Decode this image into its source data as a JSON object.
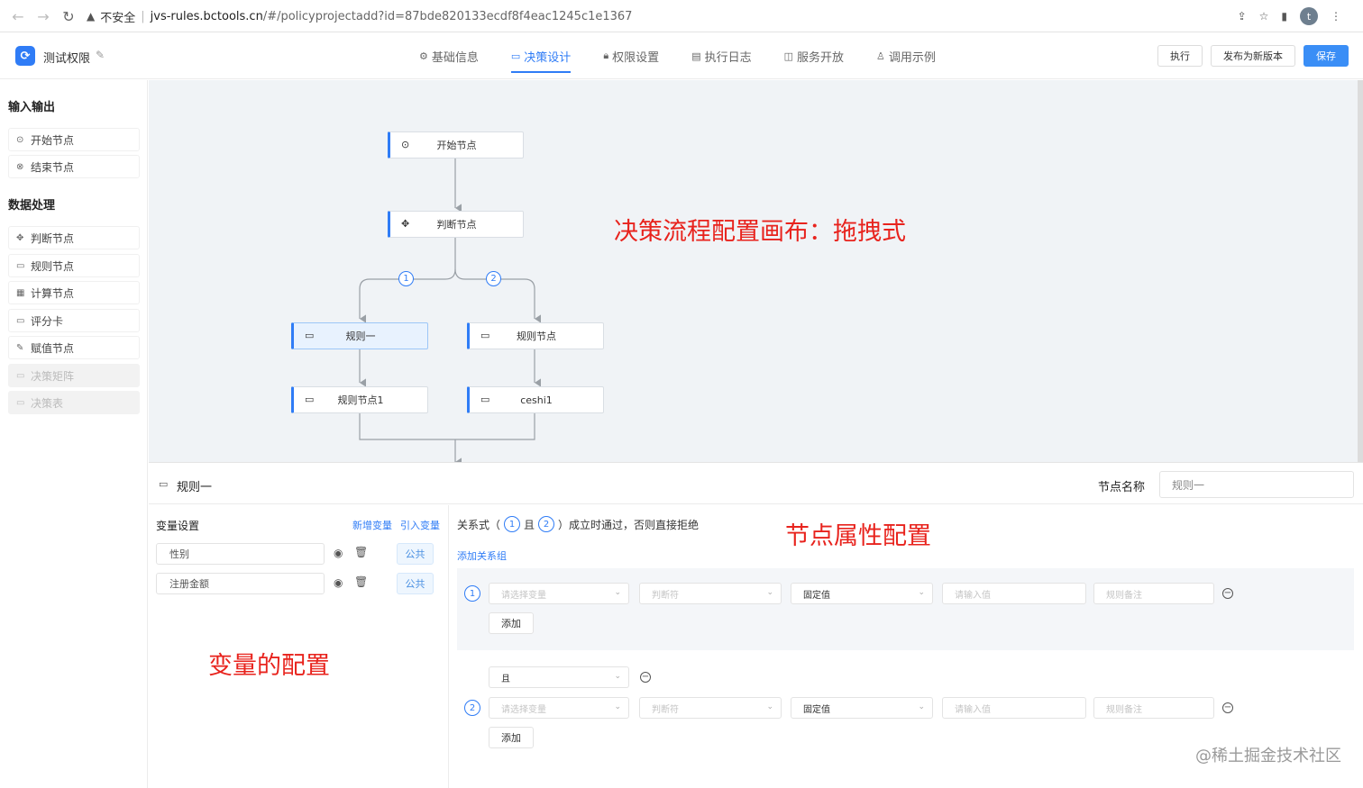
{
  "browser": {
    "security_label": "不安全",
    "url_host": "jvs-rules.bctools.cn",
    "url_path": "/#/policyprojectadd?id=87bde820133ecdf8f4eac1245c1e1367",
    "avatar_letter": "t"
  },
  "header": {
    "project_name": "测试权限",
    "tabs": [
      {
        "label": "基础信息",
        "icon": "gear-icon"
      },
      {
        "label": "决策设计",
        "icon": "monitor-icon",
        "active": true
      },
      {
        "label": "权限设置",
        "icon": "lock-icon"
      },
      {
        "label": "执行日志",
        "icon": "document-icon"
      },
      {
        "label": "服务开放",
        "icon": "book-icon"
      },
      {
        "label": "调用示例",
        "icon": "thumb-icon"
      }
    ],
    "buttons": {
      "run": "执行",
      "publish": "发布为新版本",
      "save": "保存"
    },
    "accent_color": "#2f7cf6"
  },
  "palette": {
    "io_title": "输入输出",
    "io_items": [
      {
        "label": "开始节点",
        "icon": "play-circle-icon"
      },
      {
        "label": "结束节点",
        "icon": "stop-circle-icon"
      }
    ],
    "data_title": "数据处理",
    "data_items": [
      {
        "label": "判断节点",
        "icon": "move-icon"
      },
      {
        "label": "规则节点",
        "icon": "card-icon"
      },
      {
        "label": "计算节点",
        "icon": "calculator-icon"
      },
      {
        "label": "评分卡",
        "icon": "card-icon"
      },
      {
        "label": "赋值节点",
        "icon": "edit-icon"
      },
      {
        "label": "决策矩阵",
        "icon": "card-icon",
        "disabled": true
      },
      {
        "label": "决策表",
        "icon": "card-icon",
        "disabled": true
      }
    ]
  },
  "canvas": {
    "nodes": {
      "start": "开始节点",
      "judge": "判断节点",
      "rule1": "规则一",
      "rule_node": "规则节点",
      "rule_node1": "规则节点1",
      "ceshi1": "ceshi1"
    },
    "branch_labels": [
      "1",
      "2"
    ],
    "annotation": "决策流程配置画布：拖拽式"
  },
  "properties": {
    "node_title": "规则一",
    "node_name_label": "节点名称",
    "node_name_value": "规则一",
    "annotation": "节点属性配置"
  },
  "variables": {
    "title": "变量设置",
    "add_link": "新增变量",
    "import_link": "引入变量",
    "items": [
      {
        "name": "性别",
        "tag": "公共"
      },
      {
        "name": "注册金额",
        "tag": "公共"
      }
    ],
    "annotation": "变量的配置"
  },
  "rules": {
    "relation_prefix": "关系式（",
    "relation_num1": "1",
    "relation_and": "且",
    "relation_num2": "2",
    "relation_suffix": "）成立时通过，否则直接拒绝",
    "add_group": "添加关系组",
    "var_placeholder": "请选择变量",
    "op_placeholder": "判断符",
    "value_type": "固定值",
    "value_placeholder": "请输入值",
    "note_placeholder": "规则备注",
    "add_button": "添加",
    "connector_value": "且",
    "row_nums": [
      "1",
      "2"
    ]
  },
  "watermark": "@稀土掘金技术社区"
}
